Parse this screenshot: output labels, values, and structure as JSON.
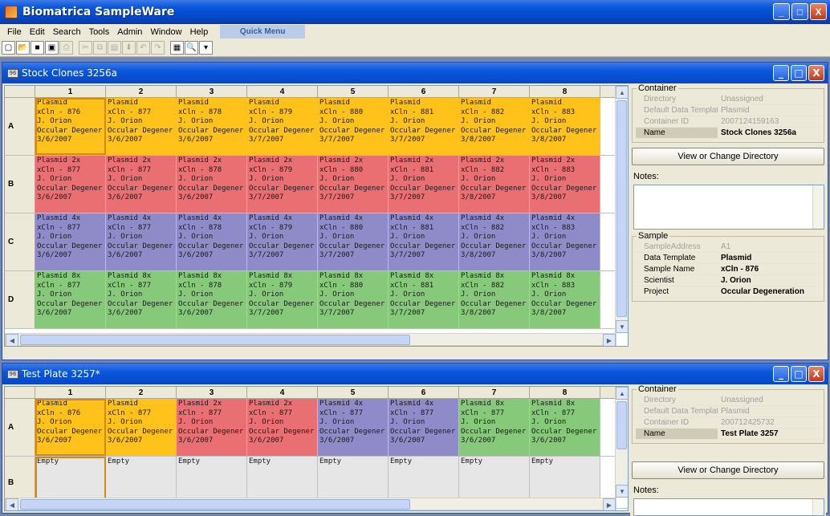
{
  "app": {
    "title": "Biomatrica SampleWare"
  },
  "menu": [
    "File",
    "Edit",
    "Search",
    "Tools",
    "Admin",
    "Window",
    "Help"
  ],
  "quick_menu": "Quick Menu",
  "toolbar": [
    "new",
    "open",
    "save",
    "save-all",
    "print",
    "cut",
    "copy",
    "paste",
    "import",
    "undo",
    "redo",
    "grid",
    "search",
    "dropdown"
  ],
  "window_buttons": {
    "minimize": "_",
    "maximize": "□",
    "close": "X"
  },
  "colors": {
    "plasmid": "#ffc21a",
    "plasmid_2x": "#ea6f73",
    "plasmid_4x": "#8f8bc9",
    "plasmid_8x": "#86c97a",
    "empty": "#e6e6e6"
  },
  "stock": {
    "title": "Stock Clones 3256a",
    "columns": [
      "1",
      "2",
      "3",
      "4",
      "5",
      "6",
      "7",
      "8"
    ],
    "rows": [
      {
        "label": "A",
        "cells": [
          [
            "Plasmid",
            "xCln - 876",
            "J. Orion",
            "Occular Degener",
            "3/6/2007"
          ],
          [
            "Plasmid",
            "xCln - 877",
            "J. Orion",
            "Occular Degener",
            "3/6/2007"
          ],
          [
            "Plasmid",
            "xCln - 878",
            "J. Orion",
            "Occular Degener",
            "3/6/2007"
          ],
          [
            "Plasmid",
            "xCln - 879",
            "J. Orion",
            "Occular Degener",
            "3/7/2007"
          ],
          [
            "Plasmid",
            "xCln - 880",
            "J. Orion",
            "Occular Degener",
            "3/7/2007"
          ],
          [
            "Plasmid",
            "xCln - 881",
            "J. Orion",
            "Occular Degener",
            "3/7/2007"
          ],
          [
            "Plasmid",
            "xCln - 882",
            "J. Orion",
            "Occular Degener",
            "3/8/2007"
          ],
          [
            "Plasmid",
            "xCln - 883",
            "J. Orion",
            "Occular Degener",
            "3/8/2007"
          ]
        ]
      },
      {
        "label": "B",
        "cells": [
          [
            "Plasmid 2x",
            "xCln - 877",
            "J. Orion",
            "Occular Degener",
            "3/6/2007"
          ],
          [
            "Plasmid 2x",
            "xCln - 877",
            "J. Orion",
            "Occular Degener",
            "3/6/2007"
          ],
          [
            "Plasmid 2x",
            "xCln - 878",
            "J. Orion",
            "Occular Degener",
            "3/6/2007"
          ],
          [
            "Plasmid 2x",
            "xCln - 879",
            "J. Orion",
            "Occular Degener",
            "3/7/2007"
          ],
          [
            "Plasmid 2x",
            "xCln - 880",
            "J. Orion",
            "Occular Degener",
            "3/7/2007"
          ],
          [
            "Plasmid 2x",
            "xCln - 881",
            "J. Orion",
            "Occular Degener",
            "3/7/2007"
          ],
          [
            "Plasmid 2x",
            "xCln - 882",
            "J. Orion",
            "Occular Degener",
            "3/8/2007"
          ],
          [
            "Plasmid 2x",
            "xCln - 883",
            "J. Orion",
            "Occular Degener",
            "3/8/2007"
          ]
        ]
      },
      {
        "label": "C",
        "cells": [
          [
            "Plasmid 4x",
            "xCln - 877",
            "J. Orion",
            "Occular Degener",
            "3/6/2007"
          ],
          [
            "Plasmid 4x",
            "xCln - 877",
            "J. Orion",
            "Occular Degener",
            "3/6/2007"
          ],
          [
            "Plasmid 4x",
            "xCln - 878",
            "J. Orion",
            "Occular Degener",
            "3/6/2007"
          ],
          [
            "Plasmid 4x",
            "xCln - 879",
            "J. Orion",
            "Occular Degener",
            "3/7/2007"
          ],
          [
            "Plasmid 4x",
            "xCln - 880",
            "J. Orion",
            "Occular Degener",
            "3/7/2007"
          ],
          [
            "Plasmid 4x",
            "xCln - 881",
            "J. Orion",
            "Occular Degener",
            "3/7/2007"
          ],
          [
            "Plasmid 4x",
            "xCln - 882",
            "J. Orion",
            "Occular Degener",
            "3/8/2007"
          ],
          [
            "Plasmid 4x",
            "xCln - 883",
            "J. Orion",
            "Occular Degener",
            "3/8/2007"
          ]
        ]
      },
      {
        "label": "D",
        "cells": [
          [
            "Plasmid 8x",
            "xCln - 877",
            "J. Orion",
            "Occular Degener",
            "3/6/2007"
          ],
          [
            "Plasmid 8x",
            "xCln - 877",
            "J. Orion",
            "Occular Degener",
            "3/6/2007"
          ],
          [
            "Plasmid 8x",
            "xCln - 878",
            "J. Orion",
            "Occular Degener",
            "3/6/2007"
          ],
          [
            "Plasmid 8x",
            "xCln - 879",
            "J. Orion",
            "Occular Degener",
            "3/7/2007"
          ],
          [
            "Plasmid 8x",
            "xCln - 880",
            "J. Orion",
            "Occular Degener",
            "3/7/2007"
          ],
          [
            "Plasmid 8x",
            "xCln - 881",
            "J. Orion",
            "Occular Degener",
            "3/7/2007"
          ],
          [
            "Plasmid 8x",
            "xCln - 882",
            "J. Orion",
            "Occular Degener",
            "3/8/2007"
          ],
          [
            "Plasmid 8x",
            "xCln - 883",
            "J. Orion",
            "Occular Degener",
            "3/8/2007"
          ]
        ]
      }
    ],
    "container": {
      "label": "Container",
      "fields": [
        {
          "k": "Directory",
          "v": "Unassigned",
          "on": false
        },
        {
          "k": "Default Data Template",
          "v": "Plasmid",
          "on": false
        },
        {
          "k": "Container ID",
          "v": "2007124159163",
          "on": false
        },
        {
          "k": "Name",
          "v": "Stock Clones 3256a",
          "on": true
        }
      ]
    },
    "view_btn": "View or Change Directory",
    "notes_label": "Notes:",
    "sample": {
      "label": "Sample",
      "fields": [
        {
          "k": "SampleAddress",
          "v": "A1",
          "on": false
        },
        {
          "k": "Data Template",
          "v": "Plasmid",
          "on": true
        },
        {
          "k": "Sample Name",
          "v": "xCln - 876",
          "on": true
        },
        {
          "k": "Scientist",
          "v": "J. Orion",
          "on": true
        },
        {
          "k": "Project",
          "v": "Occular Degeneration",
          "on": true
        }
      ]
    }
  },
  "test": {
    "title": "Test Plate 3257*",
    "columns": [
      "1",
      "2",
      "3",
      "4",
      "5",
      "6",
      "7",
      "8"
    ],
    "rows": [
      {
        "label": "A",
        "cells": [
          [
            "Plasmid",
            "xCln - 876",
            "J. Orion",
            "Occular Degener",
            "3/6/2007"
          ],
          [
            "Plasmid",
            "xCln - 877",
            "J. Orion",
            "Occular Degener",
            "3/6/2007"
          ],
          [
            "Plasmid 2x",
            "xCln - 877",
            "J. Orion",
            "Occular Degener",
            "3/6/2007"
          ],
          [
            "Plasmid 2x",
            "xCln - 877",
            "J. Orion",
            "Occular Degener",
            "3/6/2007"
          ],
          [
            "Plasmid 4x",
            "xCln - 877",
            "J. Orion",
            "Occular Degener",
            "3/6/2007"
          ],
          [
            "Plasmid 4x",
            "xCln - 877",
            "J. Orion",
            "Occular Degener",
            "3/6/2007"
          ],
          [
            "Plasmid 8x",
            "xCln - 877",
            "J. Orion",
            "Occular Degener",
            "3/6/2007"
          ],
          [
            "Plasmid 8x",
            "xCln - 877",
            "J. Orion",
            "Occular Degener",
            "3/6/2007"
          ]
        ]
      },
      {
        "label": "B",
        "cells": [
          [
            "Empty"
          ],
          [
            "Empty"
          ],
          [
            "Empty"
          ],
          [
            "Empty"
          ],
          [
            "Empty"
          ],
          [
            "Empty"
          ],
          [
            "Empty"
          ],
          [
            "Empty"
          ]
        ]
      }
    ],
    "container": {
      "label": "Container",
      "fields": [
        {
          "k": "Directory",
          "v": "Unassigned",
          "on": false
        },
        {
          "k": "Default Data Template",
          "v": "Plasmid",
          "on": false
        },
        {
          "k": "Container ID",
          "v": "200712425732",
          "on": false
        },
        {
          "k": "Name",
          "v": "Test Plate 3257",
          "on": true
        }
      ]
    },
    "view_btn": "View or Change Directory",
    "notes_label": "Notes:"
  }
}
